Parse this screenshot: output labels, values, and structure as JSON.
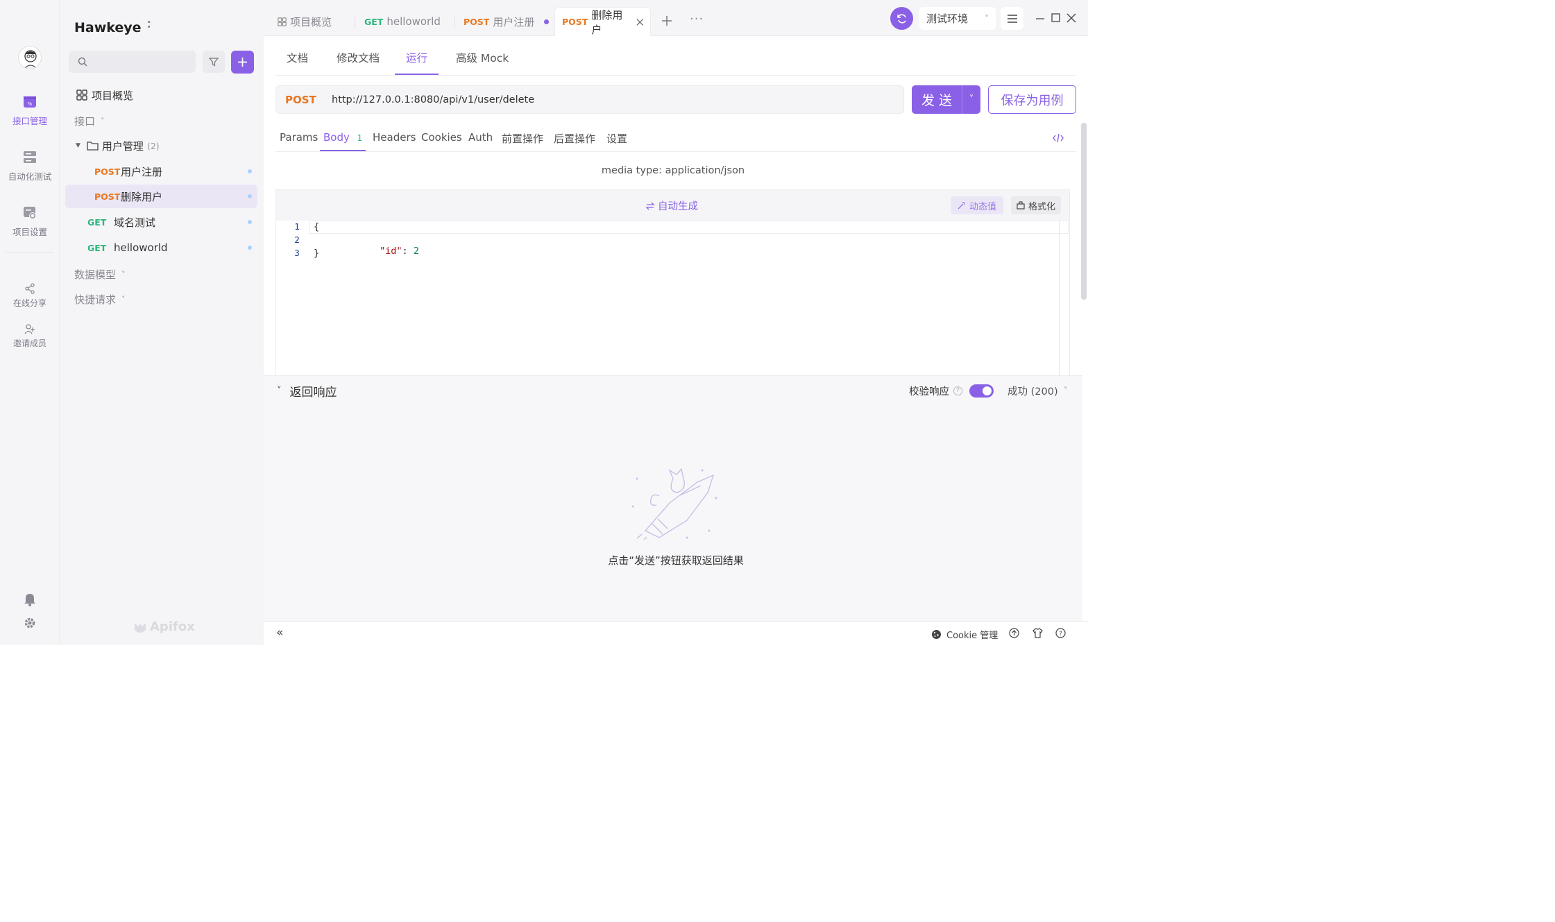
{
  "project": {
    "name": "Hawkeye"
  },
  "rail": {
    "items": [
      {
        "label": "接口管理",
        "active": true
      },
      {
        "label": "自动化测试"
      },
      {
        "label": "项目设置"
      },
      {
        "label": "在线分享"
      },
      {
        "label": "邀请成员"
      }
    ]
  },
  "sidebar": {
    "search_placeholder": "",
    "overview_label": "项目概览",
    "interfaces_label": "接口",
    "folder_label": "用户管理",
    "folder_count": "(2)",
    "items": [
      {
        "method": "POST",
        "label": "用户注册"
      },
      {
        "method": "POST",
        "label": "删除用户",
        "active": true
      },
      {
        "method": "GET",
        "label": "域名测试"
      },
      {
        "method": "GET",
        "label": "helloworld"
      }
    ],
    "data_models_label": "数据模型",
    "quick_requests_label": "快捷请求",
    "brand": "Apifox"
  },
  "tabs": [
    {
      "method": "",
      "label": "项目概览"
    },
    {
      "method": "GET",
      "label": "helloworld"
    },
    {
      "method": "POST",
      "label": "用户注册",
      "unsaved": true
    },
    {
      "method": "POST",
      "label": "删除用户",
      "active": true
    }
  ],
  "environment": {
    "selected": "测试环境"
  },
  "subtabs": [
    "文档",
    "修改文档",
    "运行",
    "高级 Mock"
  ],
  "active_subtab": "运行",
  "request": {
    "method": "POST",
    "url": "http://127.0.0.1:8080/api/v1/user/delete",
    "send_label": "发 送",
    "save_label": "保存为用例"
  },
  "request_tabs": [
    "Params",
    "Body",
    "Headers",
    "Cookies",
    "Auth",
    "前置操作",
    "后置操作",
    "设置"
  ],
  "body_count": "1",
  "body": {
    "media_type": "media type: application/json",
    "auto_generate": "自动生成",
    "dynamic_value": "动态值",
    "format": "格式化",
    "lines": [
      {
        "num": "1",
        "text": "{"
      },
      {
        "num": "2",
        "key": "\"id\"",
        "colon": ": ",
        "value": "2"
      },
      {
        "num": "3",
        "text": "}"
      }
    ]
  },
  "response": {
    "title": "返回响应",
    "validate_label": "校验响应",
    "status": "成功 (200)",
    "empty_hint": "点击“发送”按钮获取返回结果"
  },
  "statusbar": {
    "cookie_label": "Cookie 管理"
  },
  "colors": {
    "accent": "#8a61e6",
    "post": "#e8771f",
    "get": "#2cb67d"
  }
}
